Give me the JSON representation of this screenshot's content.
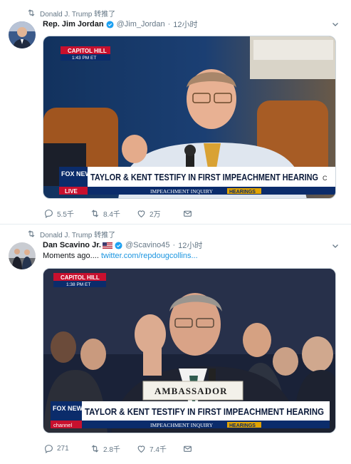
{
  "tweets": [
    {
      "retweeted_by": "Donald J. Trump 转推了",
      "name": "Rep. Jim Jordan",
      "handle": "@Jim_Jordan",
      "time": "12小时",
      "media": {
        "location_label": "CAPITOL HILL",
        "time_label": "1:43 PM ET",
        "network": "FOX NEWS",
        "network_tag": "LIVE",
        "headline": "TAYLOR & KENT TESTIFY IN FIRST IMPEACHMENT HEARING",
        "ticker": "IMPEACHMENT INQUIRY",
        "ticker_tag": "HEARINGS",
        "corner_text": "C"
      },
      "actions": {
        "replies": "5.5千",
        "retweets": "8.4千",
        "likes": "2万"
      }
    },
    {
      "retweeted_by": "Donald J. Trump 转推了",
      "name": "Dan Scavino Jr.",
      "handle": "@Scavino45",
      "time": "12小时",
      "text": "Moments ago....",
      "link": "twitter.com/repdougcollins...",
      "media": {
        "location_label": "CAPITOL HILL",
        "time_label": "1:38 PM ET",
        "network": "FOX NEWS",
        "network_tag": "channel",
        "headline": "TAYLOR & KENT TESTIFY IN FIRST IMPEACHMENT HEARING",
        "ticker": "IMPEACHMENT INQUIRY",
        "ticker_tag": "HEARINGS",
        "nameplate": "AMBASSADOR"
      },
      "actions": {
        "replies": "271",
        "retweets": "2.8千",
        "likes": "7.4千"
      }
    }
  ],
  "colors": {
    "link": "#1b95e0",
    "secondary_text": "#657786",
    "verified": "#1da1f2",
    "fox_red": "#c8102e",
    "fox_blue": "#0b2c6b"
  },
  "icons": [
    "retweet-icon",
    "verified-icon",
    "chevron-down-icon",
    "reply-icon",
    "like-icon",
    "share-icon",
    "us-flag-icon"
  ]
}
